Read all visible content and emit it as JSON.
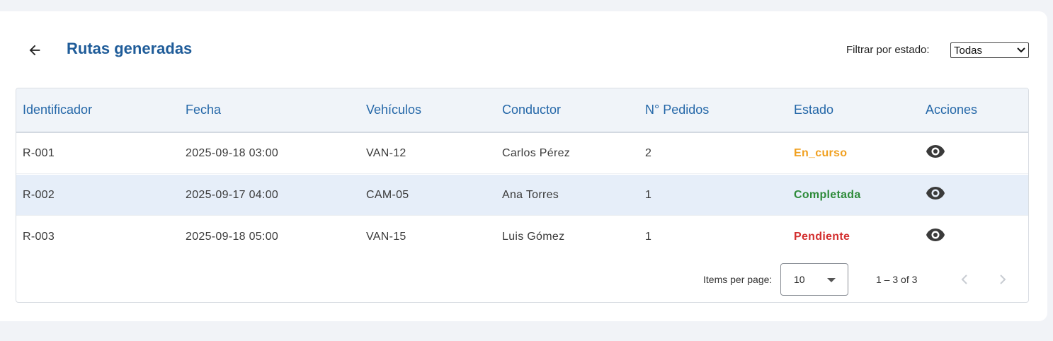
{
  "header": {
    "title": "Rutas generadas",
    "filter_label": "Filtrar por estado:",
    "filter_value": "Todas"
  },
  "table": {
    "columns": [
      "Identificador",
      "Fecha",
      "Vehículos",
      "Conductor",
      "N° Pedidos",
      "Estado",
      "Acciones"
    ],
    "rows": [
      {
        "id": "R-001",
        "fecha": "2025-09-18 03:00",
        "vehiculo": "VAN-12",
        "conductor": "Carlos Pérez",
        "pedidos": "2",
        "estado": "En_curso"
      },
      {
        "id": "R-002",
        "fecha": "2025-09-17 04:00",
        "vehiculo": "CAM-05",
        "conductor": "Ana Torres",
        "pedidos": "1",
        "estado": "Completada"
      },
      {
        "id": "R-003",
        "fecha": "2025-09-18 05:00",
        "vehiculo": "VAN-15",
        "conductor": "Luis Gómez",
        "pedidos": "1",
        "estado": "Pendiente"
      }
    ]
  },
  "status_colors": {
    "en_curso": "#f0a020",
    "completada": "#2e8b3a",
    "pendiente": "#d32f2f"
  },
  "paginator": {
    "items_per_page_label": "Items per page:",
    "items_per_page_value": "10",
    "range_label": "1 – 3 of 3"
  },
  "icons": {
    "back": "arrow-left-icon",
    "view": "eye-icon",
    "prev": "chevron-left-icon",
    "next": "chevron-right-icon"
  }
}
